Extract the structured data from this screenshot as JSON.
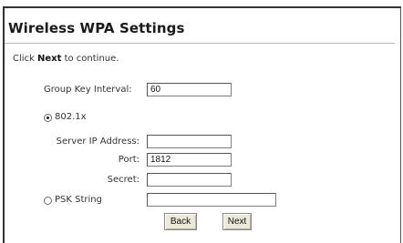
{
  "page": {
    "title": "Wireless WPA Settings",
    "intro_prefix": "Click ",
    "intro_bold": "Next",
    "intro_suffix": " to continue."
  },
  "form": {
    "group_key_interval": {
      "label": "Group Key Interval:",
      "value": "60"
    },
    "option_8021x": {
      "label": "802.1x",
      "selected": true
    },
    "server_ip": {
      "label": "Server IP Address:",
      "value": ""
    },
    "port": {
      "label": "Port:",
      "value": "1812"
    },
    "secret": {
      "label": "Secret:",
      "value": ""
    },
    "option_psk": {
      "label": "PSK String",
      "selected": false
    },
    "psk_string": {
      "value": ""
    }
  },
  "buttons": {
    "back": "Back",
    "next": "Next"
  }
}
